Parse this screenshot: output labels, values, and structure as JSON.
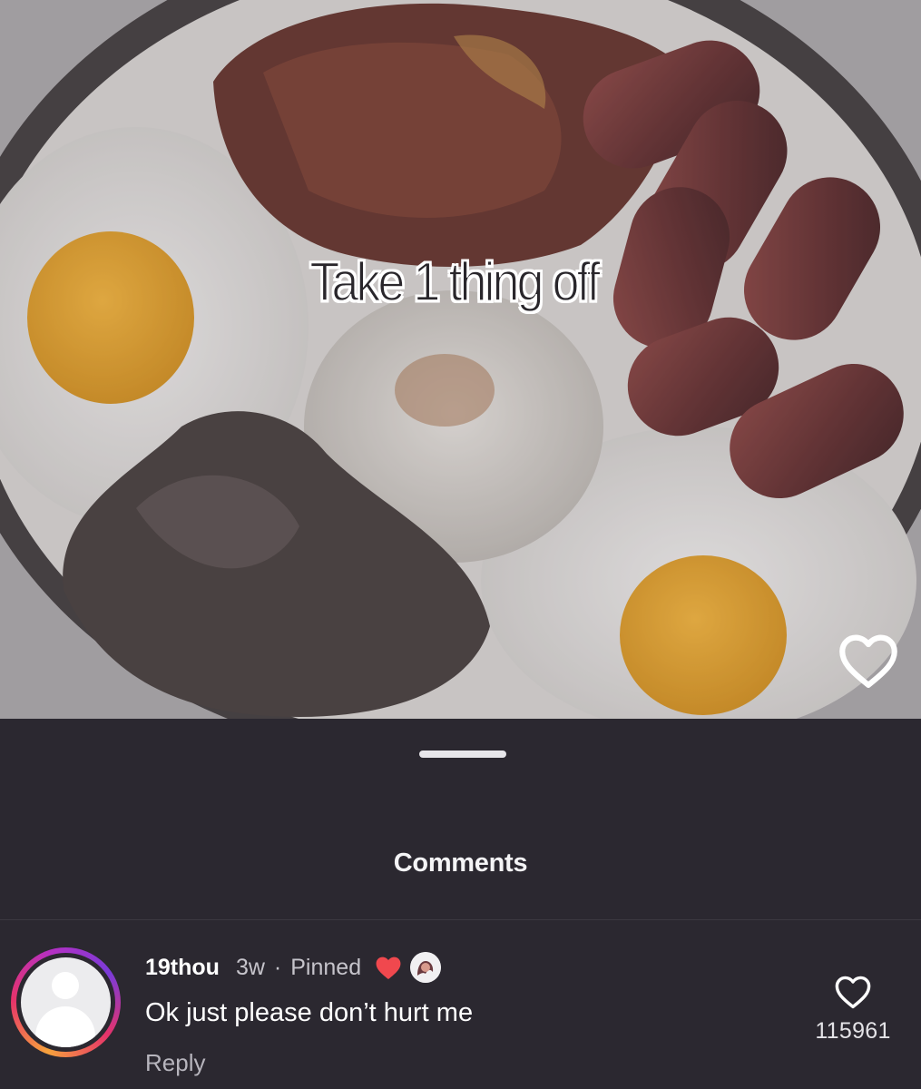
{
  "video": {
    "caption": "Take 1 thing off"
  },
  "comments_sheet": {
    "title": "Comments",
    "comment": {
      "username": "19thou",
      "age": "3w",
      "separator": "·",
      "pinned_label": "Pinned",
      "text": "Ok just please don’t hurt me",
      "reply_label": "Reply",
      "like_count": "115961"
    }
  },
  "colors": {
    "sheet_background": "#2b2830",
    "creator_heart": "#f0484e",
    "story_ring": [
      "#f7a23c",
      "#e6336a",
      "#b530c4"
    ]
  },
  "icons": {
    "overlay_like": "heart-outline-icon",
    "creator_liked": "heart-filled-icon",
    "comment_like": "heart-outline-icon"
  }
}
